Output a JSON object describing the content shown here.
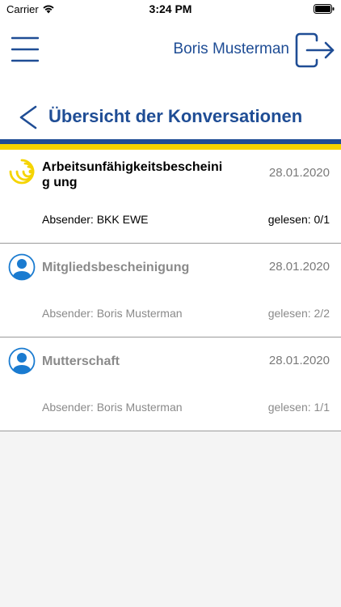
{
  "status_bar": {
    "carrier": "Carrier",
    "time": "3:24 PM"
  },
  "header": {
    "user_name": "Boris Musterman"
  },
  "page": {
    "title": "Übersicht der Konversationen"
  },
  "colors": {
    "brand_blue": "#1f4d95",
    "brand_yellow": "#f5d400",
    "icon_blue": "#1a7bd0"
  },
  "conversations": [
    {
      "subject": "Arbeitsunfähigkeitsbescheinig ung",
      "date": "28.01.2020",
      "sender": "Absender: BKK EWE",
      "read_status": "gelesen: 0/1",
      "icon": "bkk-logo-icon"
    },
    {
      "subject": "Mitgliedsbescheinigung",
      "date": "28.01.2020",
      "sender": "Absender: Boris Musterman",
      "read_status": "gelesen: 2/2",
      "icon": "user-avatar-icon"
    },
    {
      "subject": "Mutterschaft",
      "date": "28.01.2020",
      "sender": "Absender: Boris Musterman",
      "read_status": "gelesen: 1/1",
      "icon": "user-avatar-icon"
    }
  ]
}
